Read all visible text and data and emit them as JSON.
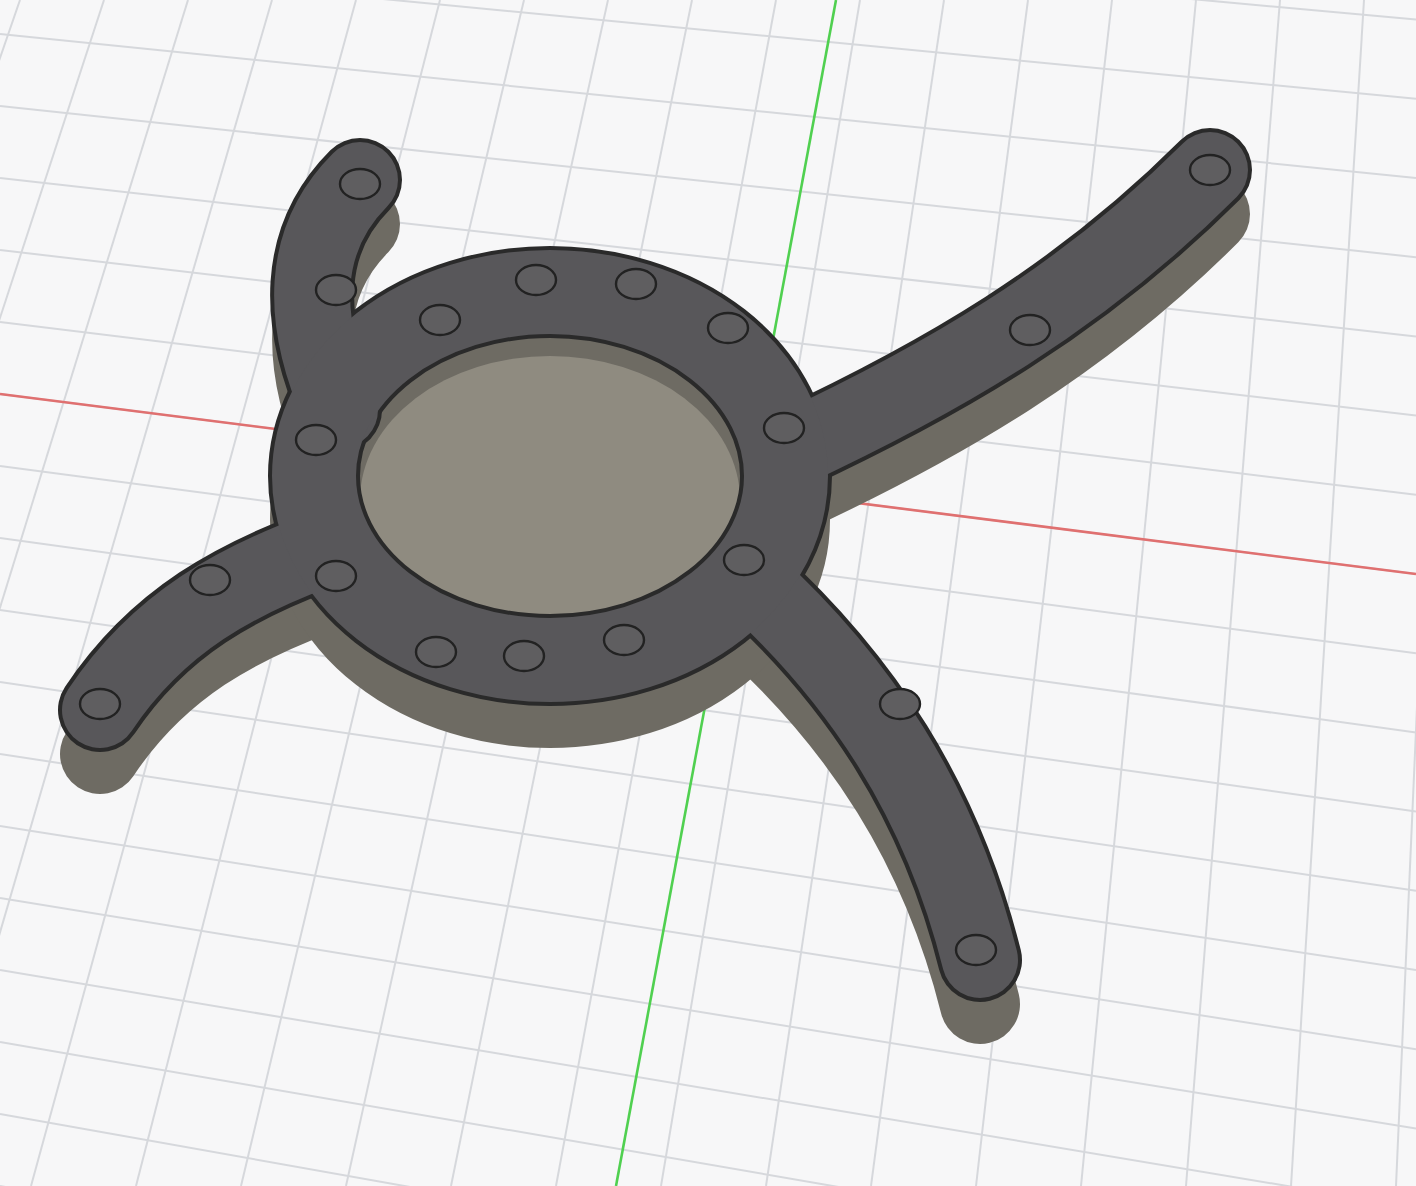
{
  "viewport": {
    "axes": [
      {
        "kind": "x",
        "color": "#e07070"
      },
      {
        "kind": "y",
        "color": "#50d050"
      }
    ]
  }
}
